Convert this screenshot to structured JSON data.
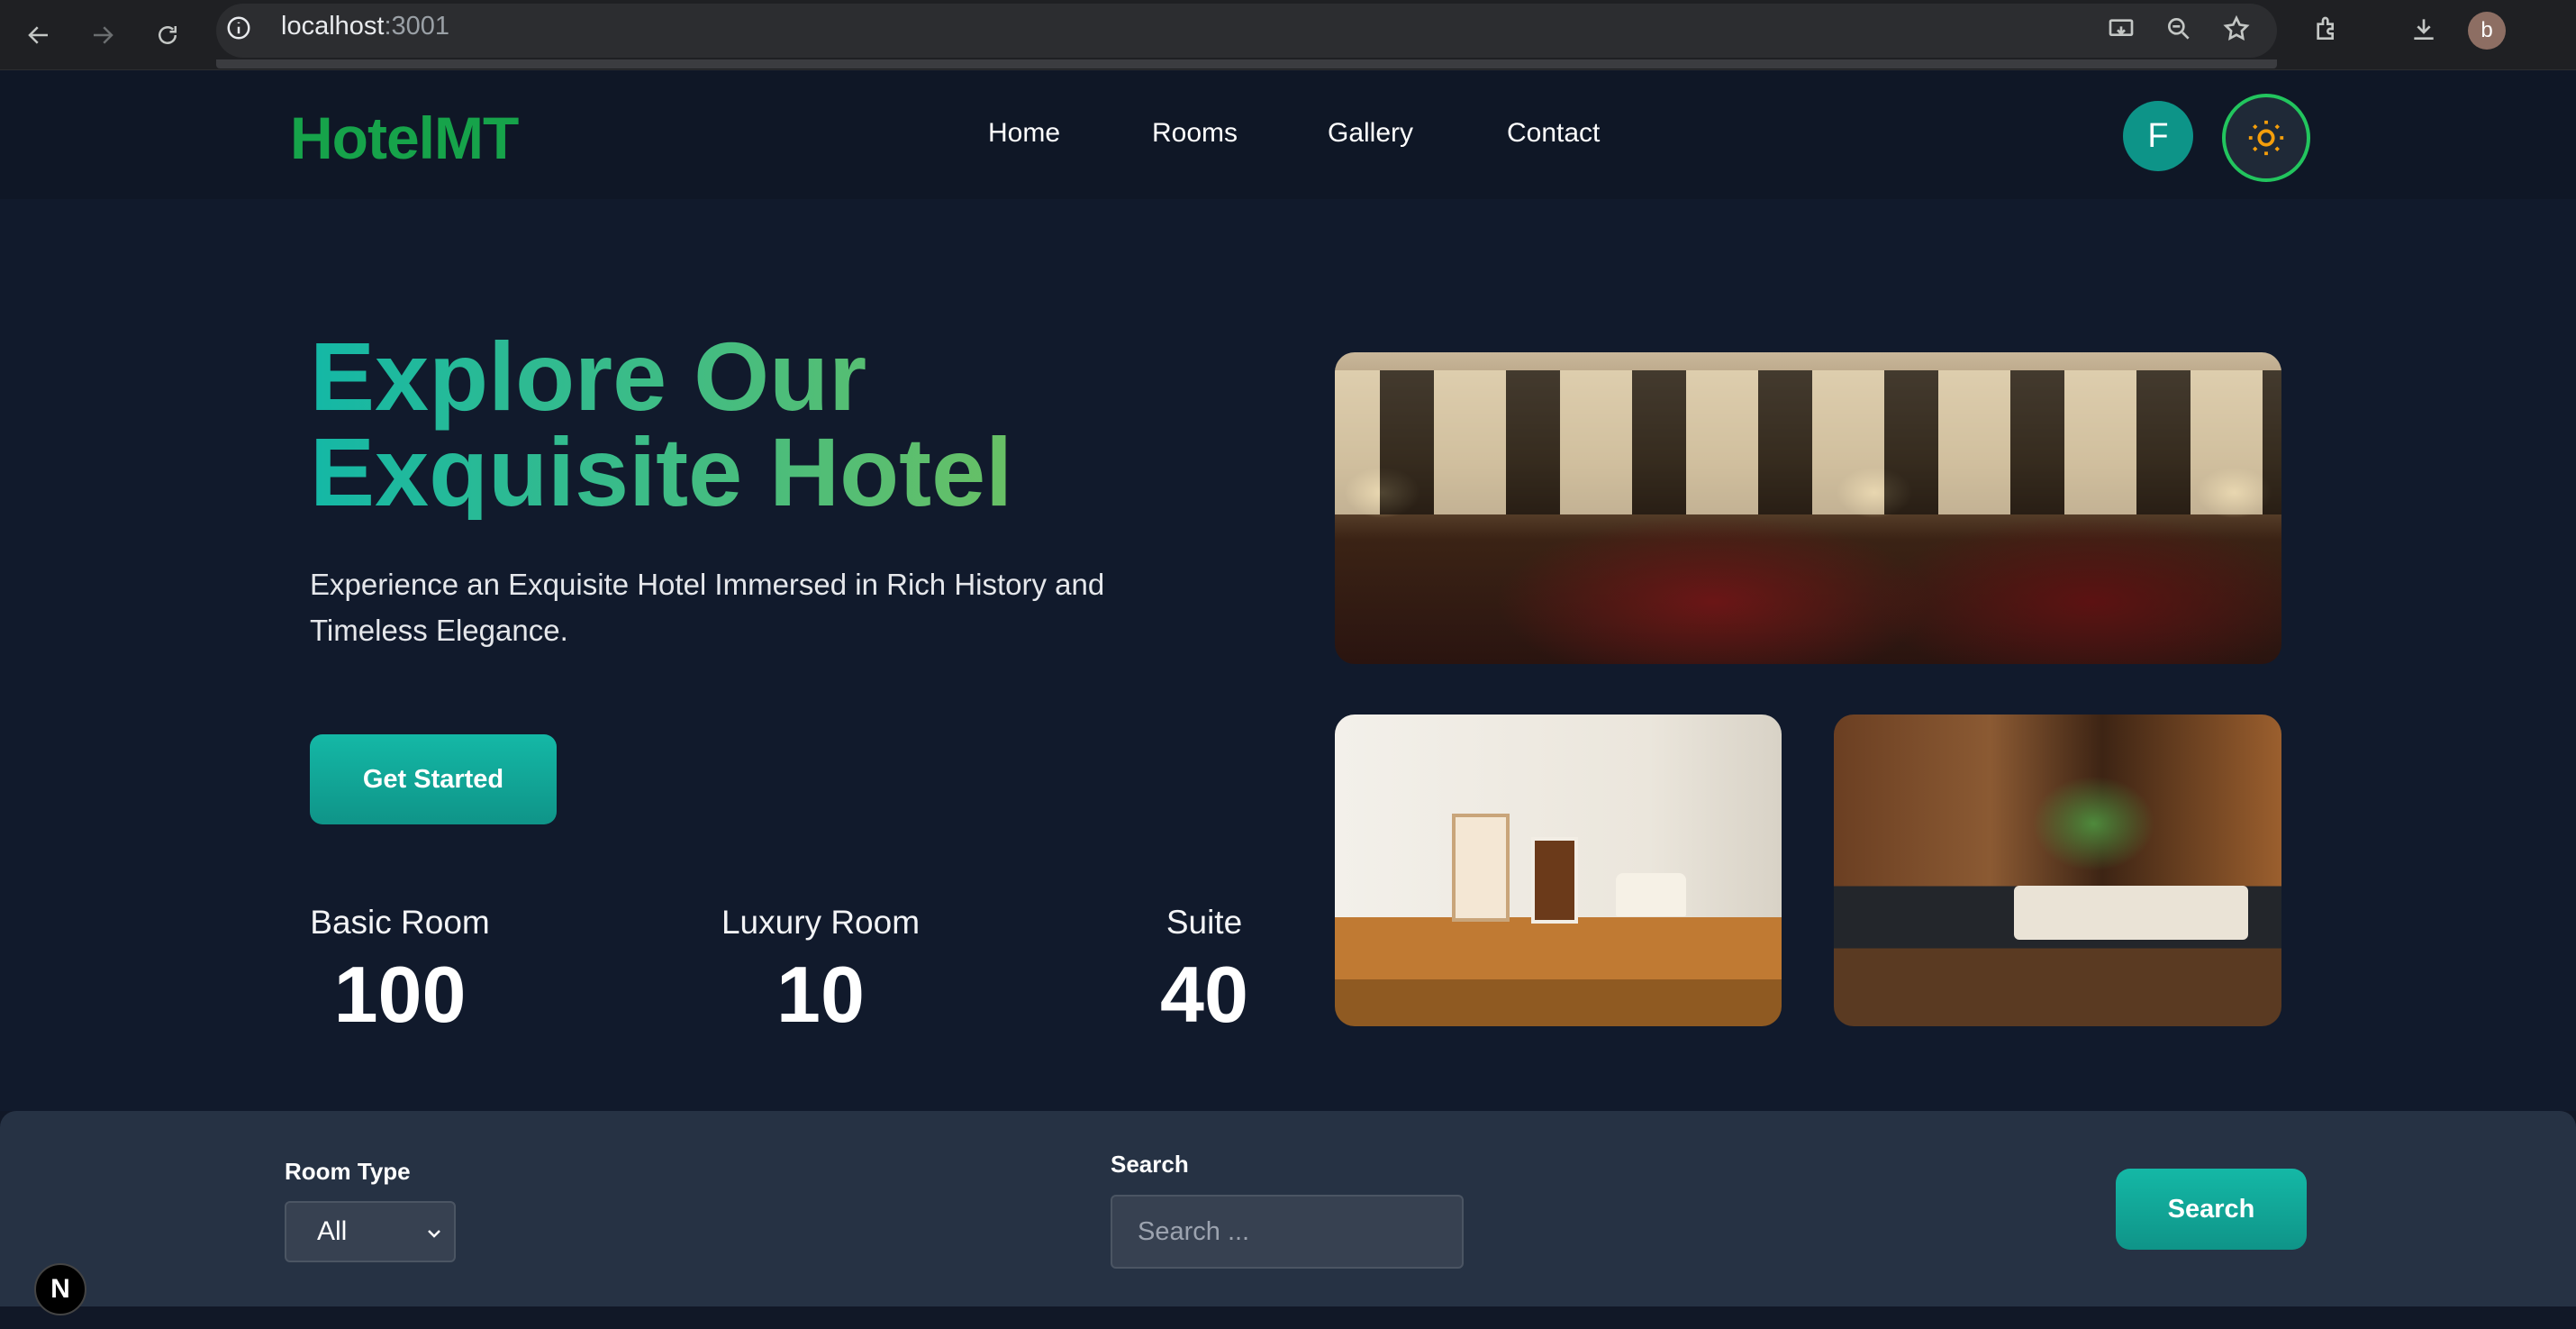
{
  "browser": {
    "url_host": "localhost",
    "url_port": ":3001",
    "profile_initial": "b",
    "icons": [
      "back-icon",
      "forward-icon",
      "reload-icon",
      "site-info-icon",
      "cast-icon",
      "zoom-icon",
      "bookmark-star-icon",
      "extensions-icon",
      "download-icon"
    ]
  },
  "header": {
    "logo": "HotelMT",
    "nav": [
      "Home",
      "Rooms",
      "Gallery",
      "Contact"
    ],
    "user_initial": "F",
    "theme_icon": "sun-icon"
  },
  "hero": {
    "title_line1": "Explore Our",
    "title_line2": "Exquisite Hotel",
    "subtitle_line1": "Experience an Exquisite Hotel Immersed in Rich History and",
    "subtitle_line2": "Timeless Elegance.",
    "cta_label": "Get Started",
    "stats": [
      {
        "label": "Basic Room",
        "value": "100"
      },
      {
        "label": "Luxury Room",
        "value": "10"
      },
      {
        "label": "Suite",
        "value": "40"
      }
    ],
    "images": [
      "hotel-lounge-photo",
      "living-room-photo",
      "bedroom-photo"
    ]
  },
  "search": {
    "room_type_label": "Room Type",
    "room_type_value": "All",
    "search_label": "Search",
    "search_placeholder": "Search ...",
    "button_label": "Search"
  },
  "dev_badge": "N",
  "colors": {
    "brand_green": "#16a34a",
    "teal_accent": "#14b8a6",
    "page_bg": "#111a2c",
    "panel_bg": "#263244"
  }
}
